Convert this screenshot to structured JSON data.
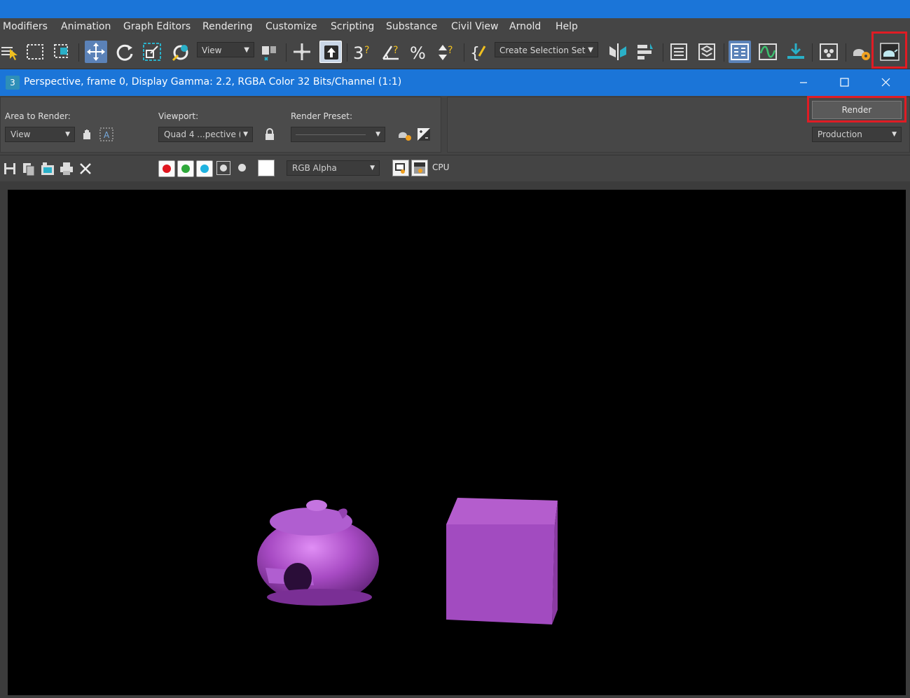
{
  "menubar": {
    "items": [
      "Modifiers",
      "Animation",
      "Graph Editors",
      "Rendering",
      "Customize",
      "Scripting",
      "Substance",
      "Civil View",
      "Arnold",
      "Help"
    ]
  },
  "toolbar": {
    "view_dropdown": "View",
    "selection_set_dropdown": "Create Selection Set",
    "icons": [
      "select-by-name-icon",
      "rectangular-selection-icon",
      "window-crossing-icon",
      "select-move-icon",
      "select-rotate-icon",
      "select-scale-icon",
      "select-place-icon",
      "view-dropdown",
      "use-pivot-icon",
      "select-manipulate-icon",
      "keyboard-shortcut-override-icon",
      "snaps-3d-icon",
      "angle-snap-icon",
      "percent-snap-icon",
      "spinner-snap-icon",
      "edit-named-selection-icon",
      "mirror-icon",
      "align-icon",
      "scene-explorer-icon",
      "layer-explorer-icon",
      "toggle-ribbon-icon",
      "curve-editor-icon",
      "schematic-view-icon",
      "material-editor-icon",
      "render-setup-icon",
      "rendered-frame-window-icon"
    ]
  },
  "render_window": {
    "title": "Perspective, frame 0, Display Gamma: 2.2, RGBA Color 32 Bits/Channel (1:1)",
    "app_badge": "3",
    "area_label": "Area to Render:",
    "area_value": "View",
    "viewport_label": "Viewport:",
    "viewport_value": "Quad 4 ...pective (",
    "preset_label": "Render Preset:",
    "preset_value": "",
    "render_button": "Render",
    "production_value": "Production",
    "channel_dropdown": "RGB Alpha",
    "cpu_label": "CPU"
  },
  "colors": {
    "title_blue": "#1b75d8",
    "highlight_red": "#e01c24",
    "object_color": "#a24bc0"
  }
}
